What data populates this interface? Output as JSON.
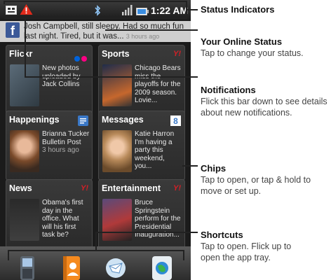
{
  "status_bar": {
    "time": "1:22 AM"
  },
  "online_status": {
    "text": "Josh Campbell, still sleepy. Had so much fun last night. Tired, but it was...",
    "ago": "3 hours ago"
  },
  "chips": [
    {
      "title": "Flickr",
      "text": "New photos uploaded by Jack Collins"
    },
    {
      "title": "Sports",
      "text": "Chicago Bears miss the playoffs for the 2009 season. Lovie..."
    },
    {
      "title": "Happenings",
      "text": "Brianna Tucker Bulletin Post",
      "ago": "3 hours ago"
    },
    {
      "title": "Messages",
      "text": "Katie Harron I'm having a party this weekend, you..."
    },
    {
      "title": "News",
      "text": "Obama's first day in the office. What will his first task be?"
    },
    {
      "title": "Entertainment",
      "text": "Bruce Springstein perform for the Presidential Inauguration..."
    }
  ],
  "annotations": [
    {
      "title": "Status Indicators"
    },
    {
      "title": "Your Online Status",
      "desc": "Tap to change your status."
    },
    {
      "title": "Notifications",
      "desc": "Flick this bar down to see details about new notifications."
    },
    {
      "title": "Chips",
      "desc": "Tap to open, or tap & hold to move or set up."
    },
    {
      "title": "Shortcuts",
      "desc": "Tap to open. Flick up to open the app tray."
    }
  ],
  "icons": {
    "status": [
      "sim-card-icon",
      "warning-icon",
      "bluetooth-icon",
      "signal-icon",
      "battery-icon"
    ],
    "badges": [
      "flickr-icon",
      "yahoo-icon",
      "happenings-icon",
      "messages-icon",
      "yahoo-icon",
      "yahoo-icon"
    ],
    "shortcuts": [
      "phone-icon",
      "contacts-icon",
      "email-icon",
      "browser-icon"
    ]
  },
  "colors": {
    "yahoo": "#d61f26",
    "facebook": "#3b5998",
    "flickr_pink": "#ff0084",
    "flickr_blue": "#0063dc"
  }
}
